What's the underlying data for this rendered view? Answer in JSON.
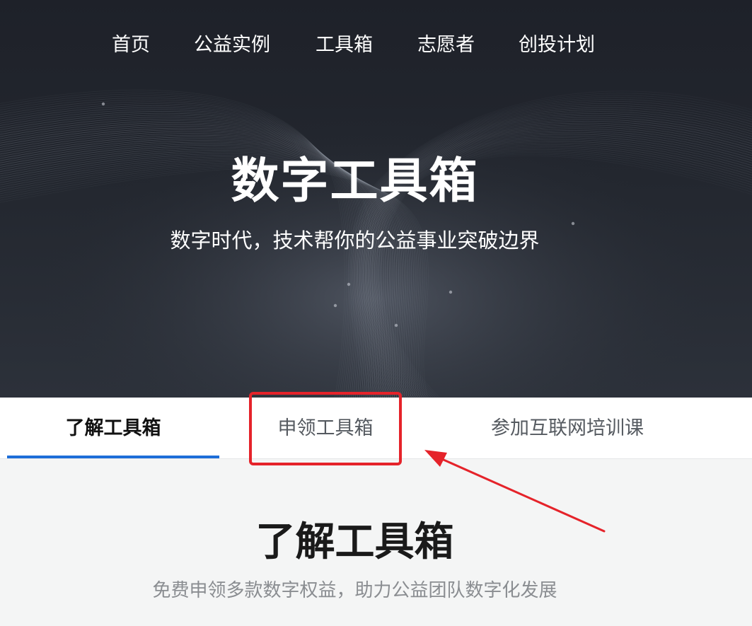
{
  "nav": {
    "items": [
      {
        "label": "首页"
      },
      {
        "label": "公益实例"
      },
      {
        "label": "工具箱"
      },
      {
        "label": "志愿者"
      },
      {
        "label": "创投计划"
      }
    ]
  },
  "hero": {
    "title": "数字工具箱",
    "subtitle": "数字时代，技术帮你的公益事业突破边界"
  },
  "tabs": [
    {
      "label": "了解工具箱",
      "active": true
    },
    {
      "label": "申领工具箱",
      "active": false
    },
    {
      "label": "参加互联网培训课",
      "active": false
    }
  ],
  "section": {
    "title": "了解工具箱",
    "subtitle": "免费申领多款数字权益，助力公益团队数字化发展"
  },
  "colors": {
    "hero_bg": "#22262e",
    "tab_underline": "#1d6ed8",
    "annotation_red": "#e5232a"
  }
}
